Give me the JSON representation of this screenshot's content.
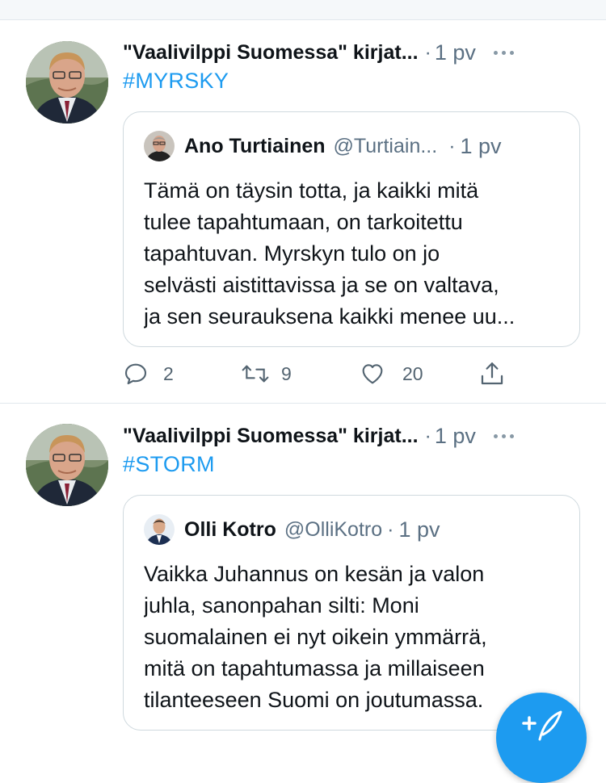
{
  "tweets": [
    {
      "author": "\"Vaalivilppi Suomessa\" kirjat...",
      "time": "1 pv",
      "hashtag": "#MYRSKY",
      "quote": {
        "name": "Ano Turtiainen",
        "handle": "@Turtiain...",
        "time": "1 pv",
        "lines": [
          "Tämä on täysin totta, ja kaikki mitä",
          "tulee tapahtumaan, on tarkoitettu",
          "tapahtuvan. Myrskyn tulo on jo",
          "selvästi aistittavissa ja se on valtava,",
          "ja sen seurauksena kaikki menee uu..."
        ]
      },
      "actions": {
        "replies": "2",
        "retweets": "9",
        "likes": "20"
      }
    },
    {
      "author": "\"Vaalivilppi Suomessa\" kirjat...",
      "time": "1 pv",
      "hashtag": "#STORM",
      "quote": {
        "name": "Olli Kotro",
        "handle": "@OlliKotro",
        "time": "1 pv",
        "lines": [
          "Vaikka Juhannus on kesän ja valon",
          "juhla, sanonpahan silti: Moni",
          "suomalainen ei nyt oikein ymmärrä,",
          "mitä on tapahtumassa ja millaiseen",
          "tilanteeseen Suomi on joutumassa."
        ]
      }
    }
  ],
  "icons": {
    "reply": "reply-icon",
    "retweet": "retweet-icon",
    "like": "heart-icon",
    "share": "share-icon",
    "more": "more-dots-icon",
    "compose": "compose-feather-icon"
  },
  "colors": {
    "accent": "#1d9bf0",
    "secondary_text": "#5b7083",
    "border": "#cfd9de"
  }
}
